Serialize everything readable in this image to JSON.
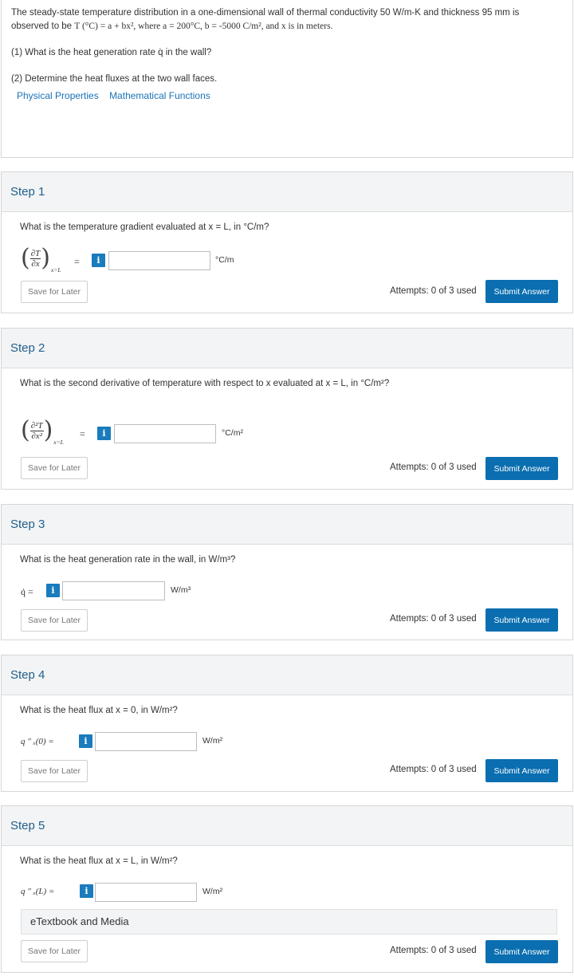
{
  "problem": {
    "line1": "The steady-state temperature distribution in a one-dimensional wall of thermal conductivity 50 W/m-K and thickness 95 mm is",
    "line2_prefix": "observed to be ",
    "line2_eq": "T (°C) = a + bx², where a = 200°C, b = -5000 C/m², and x is in meters.",
    "q1": "(1) What is the heat generation rate q̇ in the wall?",
    "q2": "(2) Determine the heat fluxes at the two wall faces.",
    "links": [
      "Physical Properties",
      "Mathematical Functions"
    ]
  },
  "common": {
    "save_label": "Save for Later",
    "attempts": "Attempts: 0 of 3 used",
    "submit_label": "Submit Answer",
    "info_glyph": "i"
  },
  "steps": [
    {
      "title": "Step 1",
      "question": "What is the temperature gradient evaluated at x = L, in °C/m?",
      "lhs_num": "∂T",
      "lhs_den": "∂x",
      "lhs_sub": "x=L",
      "value": "",
      "unit": "°C/m"
    },
    {
      "title": "Step 2",
      "question": "What is the second derivative of temperature with respect to x evaluated at x = L, in °C/m²?",
      "lhs_num": "∂²T",
      "lhs_den": "∂x²",
      "lhs_sub": "x=L",
      "value": "",
      "unit": "°C/m²"
    },
    {
      "title": "Step 3",
      "question": "What is the heat generation rate in the wall, in W/m³?",
      "lhs": "q̇ =",
      "value": "",
      "unit": "W/m³"
    },
    {
      "title": "Step 4",
      "question": "What is the heat flux at x = 0, in W/m²?",
      "lhs": "q \" ₓ(0) =",
      "value": "",
      "unit": "W/m²"
    },
    {
      "title": "Step 5",
      "question": "What is the heat flux at x = L, in W/m²?",
      "lhs": "q \" ₓ(L) =",
      "value": "",
      "unit": "W/m²",
      "etext": "eTextbook and Media"
    }
  ],
  "colors": {
    "accent": "#0a6eb0",
    "step_title": "#1f5f8b",
    "link": "#1a73b7"
  }
}
